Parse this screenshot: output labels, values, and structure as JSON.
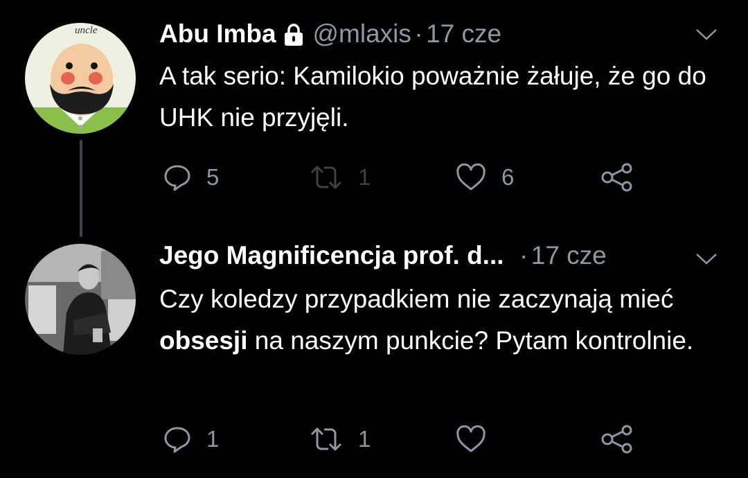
{
  "tweets": [
    {
      "name": "Abu Imba",
      "handle": "@mlaxis",
      "separator": "·",
      "date": "17 cze",
      "avatar_text": "uncle",
      "text": "A tak serio: Kamilokio poważnie żałuje, że go do UHK nie przyjęli.",
      "replies": "5",
      "retweets": "1",
      "likes": "6",
      "protected": true
    },
    {
      "name": "Jego Magnificencja prof. d...",
      "separator": "·",
      "date": "17 cze",
      "text_before": "Czy koledzy przypadkiem nie zaczynają mieć ",
      "text_bold": "obsesji",
      "text_after": " na naszym punkcie? Pytam kontrolnie.",
      "replies": "1",
      "retweets": "1"
    }
  ],
  "colors": {
    "background": "#000000",
    "text": "#ffffff",
    "muted": "#8b98a5",
    "thread_line": "#3d4148"
  },
  "icons": [
    "lock-icon",
    "chevron-down-icon",
    "reply-icon",
    "retweet-icon",
    "like-icon",
    "share-icon"
  ]
}
